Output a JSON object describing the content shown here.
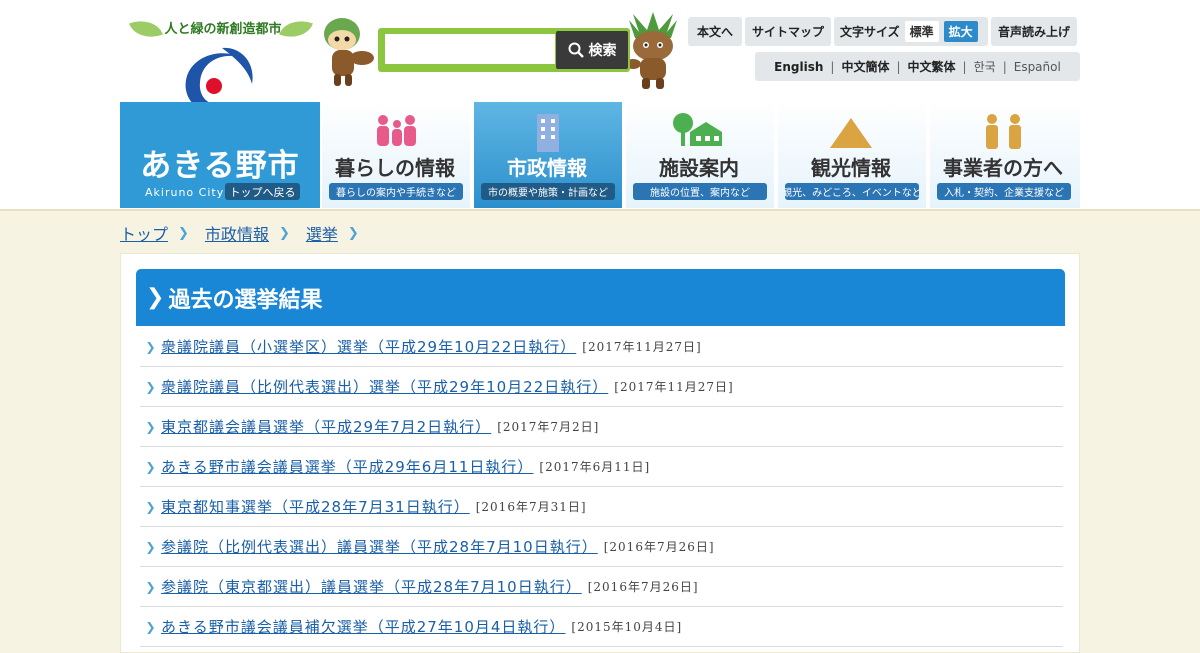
{
  "logo": {
    "tagline": "人と緑の新創造都市",
    "colors": {
      "blue": "#1f55a8",
      "green": "#3aa534",
      "red": "#e0102a"
    }
  },
  "search": {
    "placeholder": "",
    "button_label": "検索"
  },
  "utility": {
    "honbun": "本文へ",
    "sitemap": "サイトマップ",
    "fontsize_label": "文字サイズ",
    "fontsize_standard": "標準",
    "fontsize_large": "拡大",
    "voice": "音声読み上げ"
  },
  "languages": [
    "English",
    "中文簡体",
    "中文繁体",
    "한국",
    "Español"
  ],
  "home": {
    "title": "あきる野市",
    "romaji": "Akiruno City",
    "back_label": "トップへ戻る"
  },
  "nav": [
    {
      "title": "暮らしの情報",
      "sub": "暮らしの案内や手続きなど",
      "icon": "family-icon"
    },
    {
      "title": "市政情報",
      "sub": "市の概要や施策・計画など",
      "icon": "building-icon"
    },
    {
      "title": "施設案内",
      "sub": "施設の位置、案内など",
      "icon": "facility-tree-icon"
    },
    {
      "title": "観光情報",
      "sub": "観光、みどころ、イベントなど",
      "icon": "mountain-icon"
    },
    {
      "title": "事業者の方へ",
      "sub": "入札・契約、企業支援など",
      "icon": "business-people-icon"
    }
  ],
  "breadcrumb": [
    "トップ",
    "市政情報",
    "選挙"
  ],
  "section": {
    "title": "過去の選挙結果"
  },
  "results": [
    {
      "title": "衆議院議員（小選挙区）選挙（平成29年10月22日執行）",
      "date": "[2017年11月27日]"
    },
    {
      "title": "衆議院議員（比例代表選出）選挙（平成29年10月22日執行）",
      "date": "[2017年11月27日]"
    },
    {
      "title": "東京都議会議員選挙（平成29年7月2日執行）",
      "date": "[2017年7月2日]"
    },
    {
      "title": "あきる野市議会議員選挙（平成29年6月11日執行）",
      "date": "[2017年6月11日]"
    },
    {
      "title": "東京都知事選挙（平成28年7月31日執行）",
      "date": "[2016年7月31日]"
    },
    {
      "title": "参議院（比例代表選出）議員選挙（平成28年7月10日執行）",
      "date": "[2016年7月26日]"
    },
    {
      "title": "参議院（東京都選出）議員選挙（平成28年7月10日執行）",
      "date": "[2016年7月26日]"
    },
    {
      "title": "あきる野市議会議員補欠選挙（平成27年10月4日執行）",
      "date": "[2015年10月4日]"
    }
  ],
  "colors": {
    "brand_blue": "#2f9ad5",
    "heading_blue": "#1a86d6",
    "link_blue": "#1a5fa8",
    "search_green": "#8cc63f",
    "page_bg": "#f6f3e2"
  }
}
